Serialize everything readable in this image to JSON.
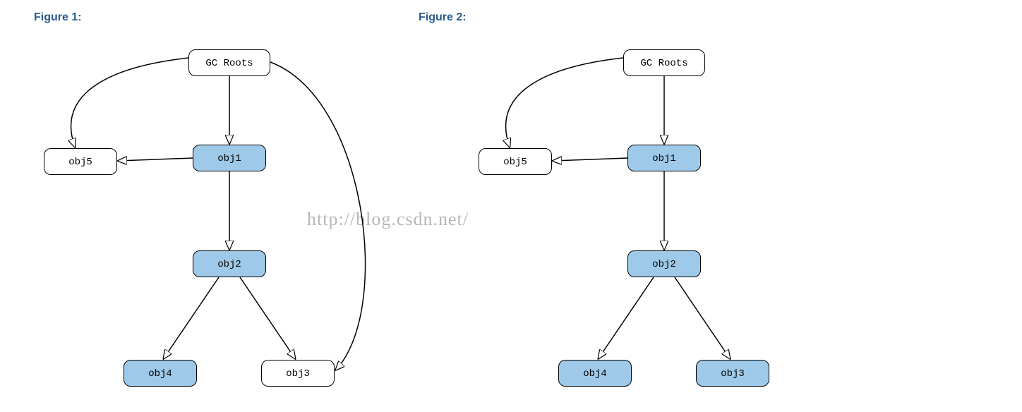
{
  "figure1": {
    "title": "Figure 1:",
    "nodes": {
      "root": {
        "label": "GC Roots",
        "blue": false
      },
      "obj1": {
        "label": "obj1",
        "blue": true
      },
      "obj2": {
        "label": "obj2",
        "blue": true
      },
      "obj3": {
        "label": "obj3",
        "blue": false
      },
      "obj4": {
        "label": "obj4",
        "blue": true
      },
      "obj5": {
        "label": "obj5",
        "blue": false
      }
    },
    "edges": [
      {
        "from": "root",
        "to": "obj1"
      },
      {
        "from": "root",
        "to": "obj5"
      },
      {
        "from": "root",
        "to": "obj3"
      },
      {
        "from": "obj1",
        "to": "obj2"
      },
      {
        "from": "obj1",
        "to": "obj5"
      },
      {
        "from": "obj2",
        "to": "obj3"
      },
      {
        "from": "obj2",
        "to": "obj4"
      }
    ]
  },
  "figure2": {
    "title": "Figure 2:",
    "nodes": {
      "root": {
        "label": "GC Roots",
        "blue": false
      },
      "obj1": {
        "label": "obj1",
        "blue": true
      },
      "obj2": {
        "label": "obj2",
        "blue": true
      },
      "obj3": {
        "label": "obj3",
        "blue": true
      },
      "obj4": {
        "label": "obj4",
        "blue": true
      },
      "obj5": {
        "label": "obj5",
        "blue": false
      }
    },
    "edges": [
      {
        "from": "root",
        "to": "obj1"
      },
      {
        "from": "root",
        "to": "obj5"
      },
      {
        "from": "obj1",
        "to": "obj2"
      },
      {
        "from": "obj1",
        "to": "obj5"
      },
      {
        "from": "obj2",
        "to": "obj3"
      },
      {
        "from": "obj2",
        "to": "obj4"
      }
    ]
  },
  "watermark": "http://blog.csdn.net/"
}
